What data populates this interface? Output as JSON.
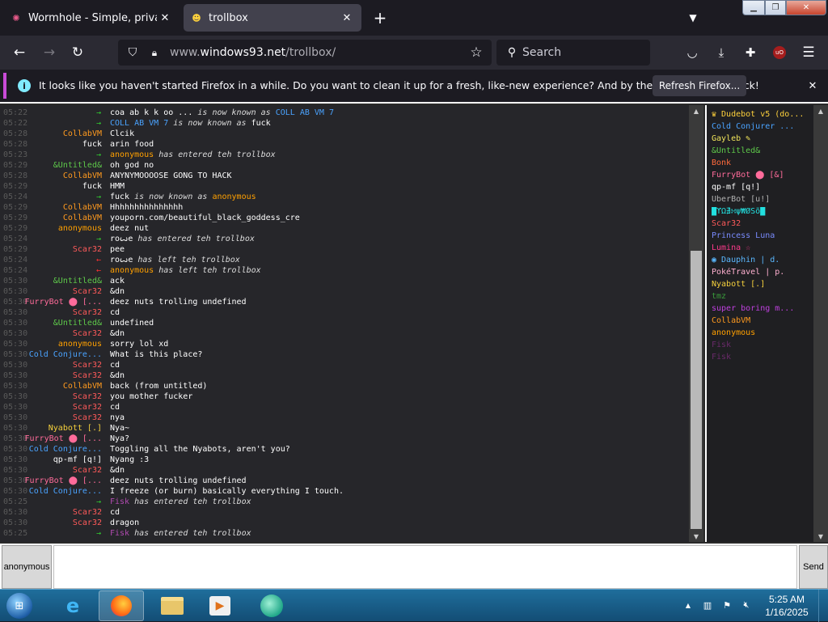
{
  "browser": {
    "tabs": [
      {
        "title": "Wormhole - Simple, private file",
        "active": false
      },
      {
        "title": "trollbox",
        "active": true
      }
    ],
    "url": {
      "host_prefix": "www.",
      "host": "windows93.net",
      "path": "/trollbox/"
    },
    "search_placeholder": "Search",
    "ublock_label": "uO",
    "notification": {
      "text": "It looks like you haven't started Firefox in a while. Do you want to clean it up for a fresh, like-new experience? And by the way, welcome back!",
      "button": "Refresh Firefox..."
    }
  },
  "chat": {
    "messages": [
      {
        "time": "05:22",
        "type": "rename",
        "old": "coa ab k k oo ...",
        "old_color": "#ffffff",
        "new": "COLL AB VM 7",
        "new_color": "#4aa3ff",
        "mid": " is now known as "
      },
      {
        "time": "05:22",
        "type": "rename",
        "old": "COLL AB VM 7",
        "old_color": "#4aa3ff",
        "new": "fuck",
        "new_color": "#ffffff",
        "mid": " is now known as "
      },
      {
        "time": "05:28",
        "type": "msg",
        "nick": "CollabVM",
        "color": "#ff9a1f",
        "text": "Clcik"
      },
      {
        "time": "05:28",
        "type": "msg",
        "nick": "fuck",
        "color": "#ffffff",
        "text": "arin food"
      },
      {
        "time": "05:23",
        "type": "join",
        "nick": "anonymous",
        "color": "#ffa000",
        "text": " has entered teh trollbox"
      },
      {
        "time": "05:29",
        "type": "msg",
        "nick": "&Untitled&",
        "color": "#5ec94a",
        "text": "oh god no"
      },
      {
        "time": "05:28",
        "type": "msg",
        "nick": "CollabVM",
        "color": "#ff9a1f",
        "text": "ANYNYMOOOOSE GONG TO HACK"
      },
      {
        "time": "05:29",
        "type": "msg",
        "nick": "fuck",
        "color": "#ffffff",
        "text": "HMM"
      },
      {
        "time": "05:24",
        "type": "rename",
        "old": "fuck",
        "old_color": "#ffffff",
        "new": "anonymous",
        "new_color": "#ffa000",
        "mid": " is now known as "
      },
      {
        "time": "05:29",
        "type": "msg",
        "nick": "CollabVM",
        "color": "#ff9a1f",
        "text": "Hhhhhhhhhhhhhhh"
      },
      {
        "time": "05:29",
        "type": "msg",
        "nick": "CollabVM",
        "color": "#ff9a1f",
        "text": "youporn.com/beautiful_black_goddess_cre"
      },
      {
        "time": "05:29",
        "type": "msg",
        "nick": "anonymous",
        "color": "#ffa000",
        "text": "deez nut"
      },
      {
        "time": "05:24",
        "type": "join",
        "nick": "roꙍe",
        "color": "#ffffff",
        "text": " has entered teh trollbox"
      },
      {
        "time": "05:29",
        "type": "msg",
        "nick": "Scar32",
        "color": "#ff5a5a",
        "text": "pee"
      },
      {
        "time": "05:24",
        "type": "leave",
        "nick": "roꙍe",
        "color": "#ffffff",
        "text": " has left teh trollbox"
      },
      {
        "time": "05:24",
        "type": "leave",
        "nick": "anonymous",
        "color": "#ffa000",
        "text": " has left teh trollbox"
      },
      {
        "time": "05:30",
        "type": "msg",
        "nick": "&Untitled&",
        "color": "#5ec94a",
        "text": "ack"
      },
      {
        "time": "05:30",
        "type": "msg",
        "nick": "Scar32",
        "color": "#ff5a5a",
        "text": "&dn"
      },
      {
        "time": "05:30",
        "type": "msg",
        "nick": "FurryBot ⬤ [...",
        "color": "#ff6b9a",
        "text": "deez nuts trolling undefined"
      },
      {
        "time": "05:30",
        "type": "msg",
        "nick": "Scar32",
        "color": "#ff5a5a",
        "text": "cd"
      },
      {
        "time": "05:30",
        "type": "msg",
        "nick": "&Untitled&",
        "color": "#5ec94a",
        "text": "undefined"
      },
      {
        "time": "05:30",
        "type": "msg",
        "nick": "Scar32",
        "color": "#ff5a5a",
        "text": "&dn"
      },
      {
        "time": "05:30",
        "type": "msg",
        "nick": "anonymous",
        "color": "#ffa000",
        "text": "sorry lol xd"
      },
      {
        "time": "05:30",
        "type": "msg",
        "nick": "Cold Conjure...",
        "color": "#4aa3ff",
        "text": "What is this place?"
      },
      {
        "time": "05:30",
        "type": "msg",
        "nick": "Scar32",
        "color": "#ff5a5a",
        "text": "cd"
      },
      {
        "time": "05:30",
        "type": "msg",
        "nick": "Scar32",
        "color": "#ff5a5a",
        "text": "&dn"
      },
      {
        "time": "05:30",
        "type": "msg",
        "nick": "CollabVM",
        "color": "#ff9a1f",
        "text": "back (from untitled)"
      },
      {
        "time": "05:30",
        "type": "msg",
        "nick": "Scar32",
        "color": "#ff5a5a",
        "text": "you mother fucker"
      },
      {
        "time": "05:30",
        "type": "msg",
        "nick": "Scar32",
        "color": "#ff5a5a",
        "text": "cd"
      },
      {
        "time": "05:30",
        "type": "msg",
        "nick": "Scar32",
        "color": "#ff5a5a",
        "text": "nya"
      },
      {
        "time": "05:30",
        "type": "msg",
        "nick": "Nyabott [.]",
        "color": "#f5d03c",
        "text": "Nya~"
      },
      {
        "time": "05:30",
        "type": "msg",
        "nick": "FurryBot ⬤ [...",
        "color": "#ff6b9a",
        "text": "Nya?"
      },
      {
        "time": "05:30",
        "type": "msg",
        "nick": "Cold Conjure...",
        "color": "#4aa3ff",
        "text": "Toggling all the Nyabots, aren't you?"
      },
      {
        "time": "05:30",
        "type": "msg",
        "nick": "qp-mf [q!]",
        "color": "#ffffff",
        "text": "Nyang :3"
      },
      {
        "time": "05:30",
        "type": "msg",
        "nick": "Scar32",
        "color": "#ff5a5a",
        "text": "&dn"
      },
      {
        "time": "05:30",
        "type": "msg",
        "nick": "FurryBot ⬤ [...",
        "color": "#ff6b9a",
        "text": "deez nuts trolling undefined"
      },
      {
        "time": "05:30",
        "type": "msg",
        "nick": "Cold Conjure...",
        "color": "#4aa3ff",
        "text": "I freeze (or burn) basically everything I touch."
      },
      {
        "time": "05:25",
        "type": "join",
        "nick": "Fisk",
        "color": "#b04ab0",
        "text": " has entered teh trollbox"
      },
      {
        "time": "05:30",
        "type": "msg",
        "nick": "Scar32",
        "color": "#ff5a5a",
        "text": "cd"
      },
      {
        "time": "05:30",
        "type": "msg",
        "nick": "Scar32",
        "color": "#ff5a5a",
        "text": "dragon"
      },
      {
        "time": "05:25",
        "type": "join",
        "nick": "Fisk",
        "color": "#b04ab0",
        "text": " has entered teh trollbox"
      }
    ],
    "users": [
      {
        "name": "♛ Dudebot v5 (do...",
        "color": "#ffd23c"
      },
      {
        "name": "Cold Conjurer ...",
        "color": "#4aa3ff"
      },
      {
        "name": "Gayleb ✎",
        "color": "#f0e45a"
      },
      {
        "name": "&Untitled&",
        "color": "#5ec94a"
      },
      {
        "name": "Bonk",
        "color": "#ff6a3c"
      },
      {
        "name": "FurryBot ⬤ [&]",
        "color": "#ff6b9a"
      },
      {
        "name": "qp-mf [q!]",
        "color": "#ffffff"
      },
      {
        "name": "UberBot [u!]",
        "color": "#b0b0b0"
      },
      {
        "name": "█ϓΩ∄∺ψ₩ØŜȭ█",
        "color": "#22e0e0"
      },
      {
        "name": "Scar32",
        "color": "#ff5a5a"
      },
      {
        "name": "Princess Luna",
        "color": "#7a8cff"
      },
      {
        "name": "Lumina ☆",
        "color": "#ff3a8c"
      },
      {
        "name": "◉ Dauphin | d.",
        "color": "#5ab8ff"
      },
      {
        "name": "PokéTravel | p.",
        "color": "#ffb0d0"
      },
      {
        "name": "Nyabott [.]",
        "color": "#f5d03c"
      },
      {
        "name": "tmz",
        "color": "#3a9a3a"
      },
      {
        "name": "super boring m...",
        "color": "#c040e0"
      },
      {
        "name": "CollabVM",
        "color": "#ff9a1f"
      },
      {
        "name": "anonymous",
        "color": "#ffa000"
      },
      {
        "name": "Fisk",
        "color": "#6a2a6a"
      },
      {
        "name": "Fisk",
        "color": "#6a2a6a"
      }
    ],
    "nick_button": "anonymous",
    "input_value": "",
    "send_label": "Send"
  },
  "taskbar": {
    "clock_time": "5:25 AM",
    "clock_date": "1/16/2025"
  }
}
